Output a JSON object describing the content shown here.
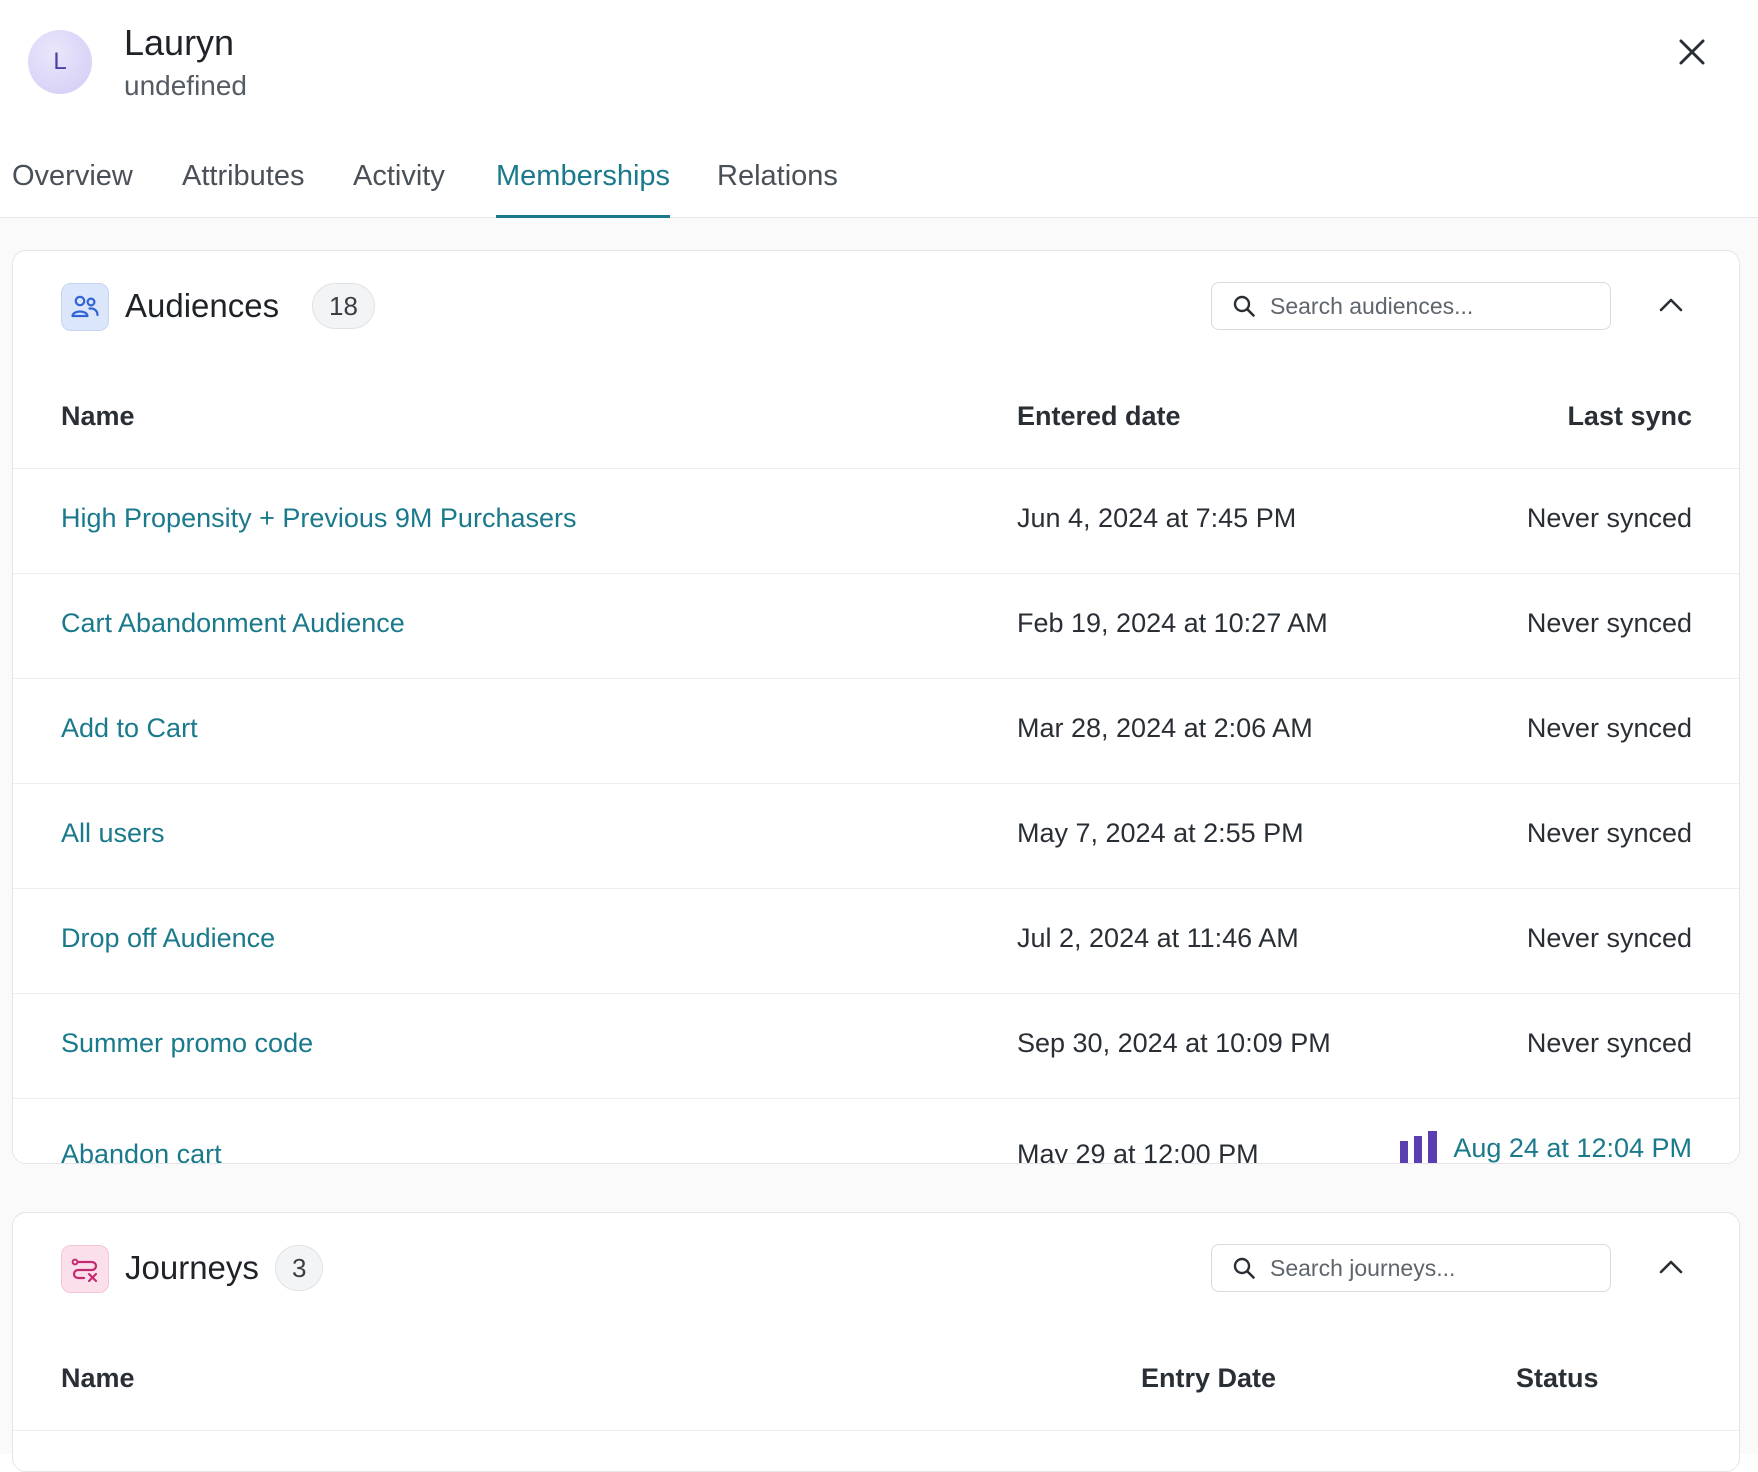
{
  "profile": {
    "avatar_initial": "L",
    "name": "Lauryn",
    "subtitle": "undefined"
  },
  "tabs": [
    {
      "label": "Overview",
      "active": false
    },
    {
      "label": "Attributes",
      "active": false
    },
    {
      "label": "Activity",
      "active": false
    },
    {
      "label": "Memberships",
      "active": true
    },
    {
      "label": "Relations",
      "active": false
    }
  ],
  "audiences": {
    "title": "Audiences",
    "count": "18",
    "search_placeholder": "Search audiences...",
    "columns": {
      "name": "Name",
      "entered_date": "Entered date",
      "last_sync": "Last sync"
    },
    "rows": [
      {
        "name": "High Propensity + Previous 9M Purchasers",
        "entered": "Jun 4, 2024 at 7:45 PM",
        "sync": "Never synced"
      },
      {
        "name": "Cart Abandonment Audience",
        "entered": "Feb 19, 2024 at 10:27 AM",
        "sync": "Never synced"
      },
      {
        "name": "Add to Cart",
        "entered": "Mar 28, 2024 at 2:06 AM",
        "sync": "Never synced"
      },
      {
        "name": "All users",
        "entered": "May 7, 2024 at 2:55 PM",
        "sync": "Never synced"
      },
      {
        "name": "Drop off Audience",
        "entered": "Jul 2, 2024 at 11:46 AM",
        "sync": "Never synced"
      },
      {
        "name": "Summer promo code",
        "entered": "Sep 30, 2024 at 10:09 PM",
        "sync": "Never synced"
      },
      {
        "name": "Abandon cart",
        "entered": "May 29 at 12:00 PM",
        "sync": "Aug 24 at 12:04 PM"
      }
    ]
  },
  "journeys": {
    "title": "Journeys",
    "count": "3",
    "search_placeholder": "Search journeys...",
    "columns": {
      "name": "Name",
      "entry_date": "Entry Date",
      "status": "Status"
    }
  },
  "colors": {
    "accent": "#1a7a8c",
    "sync_icon": "#5a3fb0"
  },
  "icons": {
    "close": "close-icon",
    "audiences": "people-icon",
    "journeys": "journey-icon",
    "search": "search-icon",
    "collapse": "chevron-up-icon",
    "destination": "bars-logo-icon"
  }
}
